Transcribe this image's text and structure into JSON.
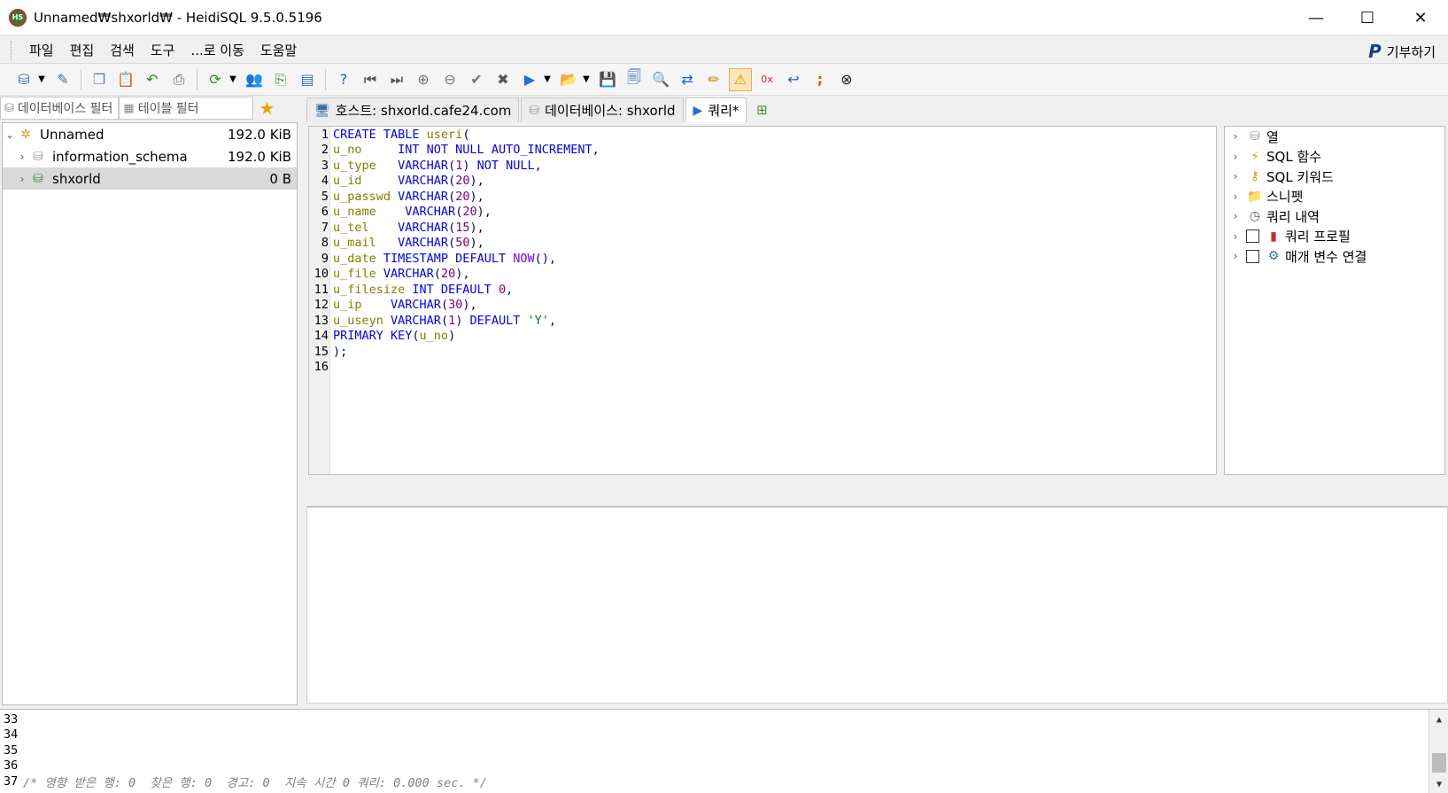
{
  "window": {
    "title": "Unnamed₩shxorld₩ - HeidiSQL 9.5.0.5196",
    "logo": "HS",
    "controls": {
      "minimize": "—",
      "maximize": "☐",
      "close": "✕"
    }
  },
  "menu": {
    "items": [
      "파일",
      "편집",
      "검색",
      "도구",
      "...로 이동",
      "도움말"
    ],
    "donate_label": "기부하기"
  },
  "filters": {
    "database_filter": "데이터베이스 필터",
    "table_filter": "테이블 필터"
  },
  "tree": {
    "rows": [
      {
        "name": "Unnamed",
        "size": "192.0 KiB",
        "icon": "server-icon"
      },
      {
        "name": "information_schema",
        "size": "192.0 KiB",
        "icon": "database-icon"
      },
      {
        "name": "shxorld",
        "size": "0 B",
        "icon": "database-icon"
      }
    ]
  },
  "tabs": {
    "host": "호스트: shxorld.cafe24.com",
    "database": "데이터베이스: shxorld",
    "query": "쿼리*"
  },
  "editor": {
    "line_numbers": [
      "1",
      "2",
      "3",
      "4",
      "5",
      "6",
      "7",
      "8",
      "9",
      "10",
      "11",
      "12",
      "13",
      "14",
      "15",
      "16"
    ]
  },
  "helpers": {
    "items": [
      "열",
      "SQL 함수",
      "SQL 키워드",
      "스니펫",
      "쿼리 내역",
      "쿼리 프로필",
      "매개 변수 연결"
    ]
  },
  "log": {
    "line_numbers": [
      "33",
      "34",
      "35",
      "36",
      "37"
    ],
    "message": "/* 영향 받은 행: 0  찾은 행: 0  경고: 0  지속 시간 0 쿼리: 0.000 sec. */"
  },
  "colors": {
    "keyword": "#0000ff",
    "function": "#8000ff",
    "identifier": "#808000",
    "number": "#800080",
    "string": "#008000"
  }
}
